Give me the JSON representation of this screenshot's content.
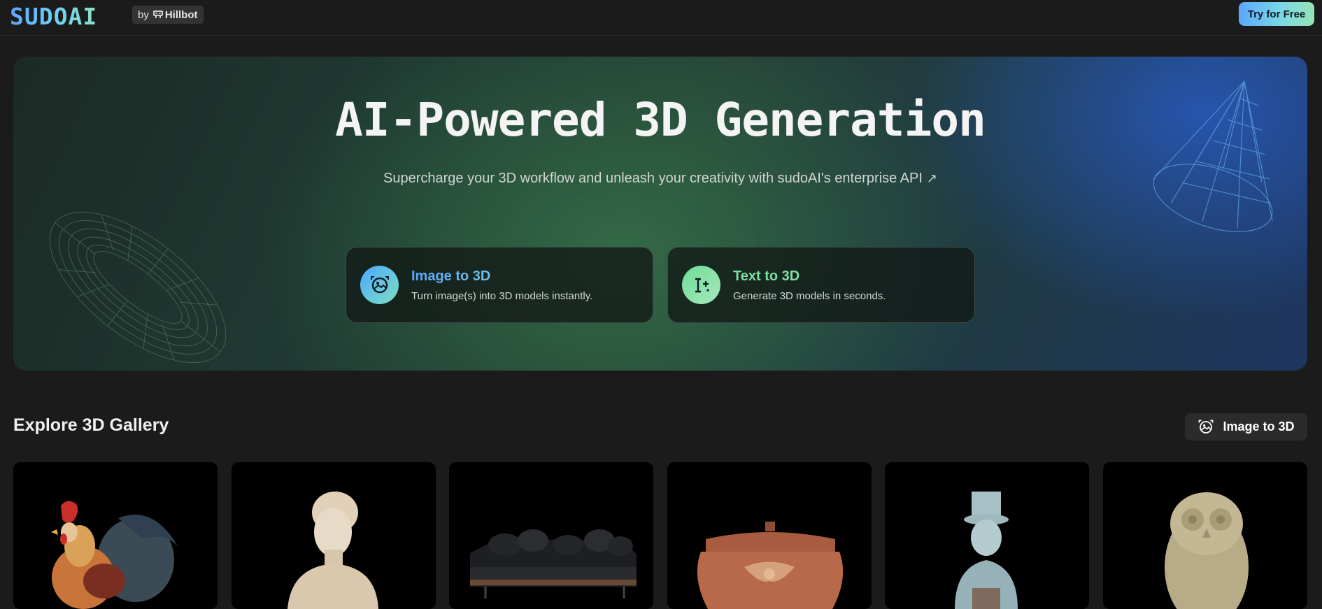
{
  "nav": {
    "logo": "SUDOAI",
    "by_label": "by",
    "brand": "Hillbot",
    "cta": "Try for Free"
  },
  "hero": {
    "title": "AI-Powered 3D Generation",
    "subtitle": "Supercharge your 3D workflow and unleash your creativity with sudoAI's enterprise API",
    "cards": [
      {
        "title": "Image to 3D",
        "desc": "Turn image(s) into 3D models instantly.",
        "icon": "image-to-3d-icon"
      },
      {
        "title": "Text to 3D",
        "desc": "Generate 3D models in seconds.",
        "icon": "text-to-3d-icon"
      }
    ]
  },
  "gallery": {
    "title": "Explore 3D Gallery",
    "button": "Image to 3D",
    "items": [
      "rooster",
      "bust",
      "sofa",
      "ornate-box",
      "top-hat-figure",
      "owl"
    ]
  },
  "colors": {
    "background": "#1b1b1b",
    "accent_blue": "#5aa7ff",
    "accent_green": "#7fe0a3"
  }
}
